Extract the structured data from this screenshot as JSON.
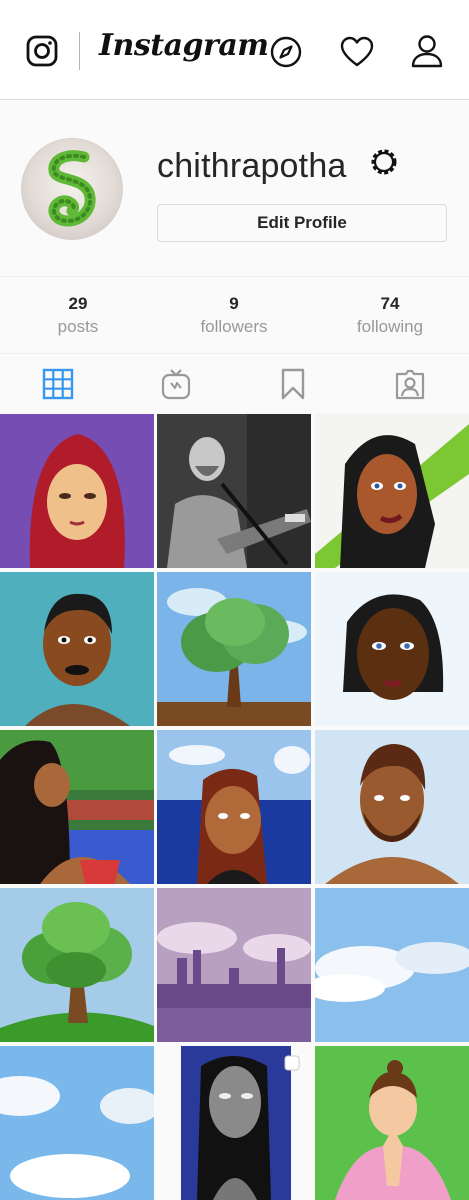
{
  "header": {
    "app_name": "Instagram",
    "icons": [
      "camera-icon",
      "explore-compass-icon",
      "activity-heart-icon",
      "profile-person-icon"
    ]
  },
  "profile": {
    "username": "chithrapotha",
    "edit_button_label": "Edit Profile",
    "settings_icon": "gear-icon"
  },
  "stats": [
    {
      "number": "29",
      "label": "posts"
    },
    {
      "number": "9",
      "label": "followers"
    },
    {
      "number": "74",
      "label": "following"
    }
  ],
  "tabs": [
    {
      "icon": "grid-icon",
      "active": true
    },
    {
      "icon": "igtv-icon",
      "active": false
    },
    {
      "icon": "saved-bookmark-icon",
      "active": false
    },
    {
      "icon": "tagged-icon",
      "active": false
    }
  ],
  "colors": {
    "active_tab": "#3897f0",
    "text": "#262626",
    "muted": "#999999",
    "border": "#dbdbdb"
  }
}
